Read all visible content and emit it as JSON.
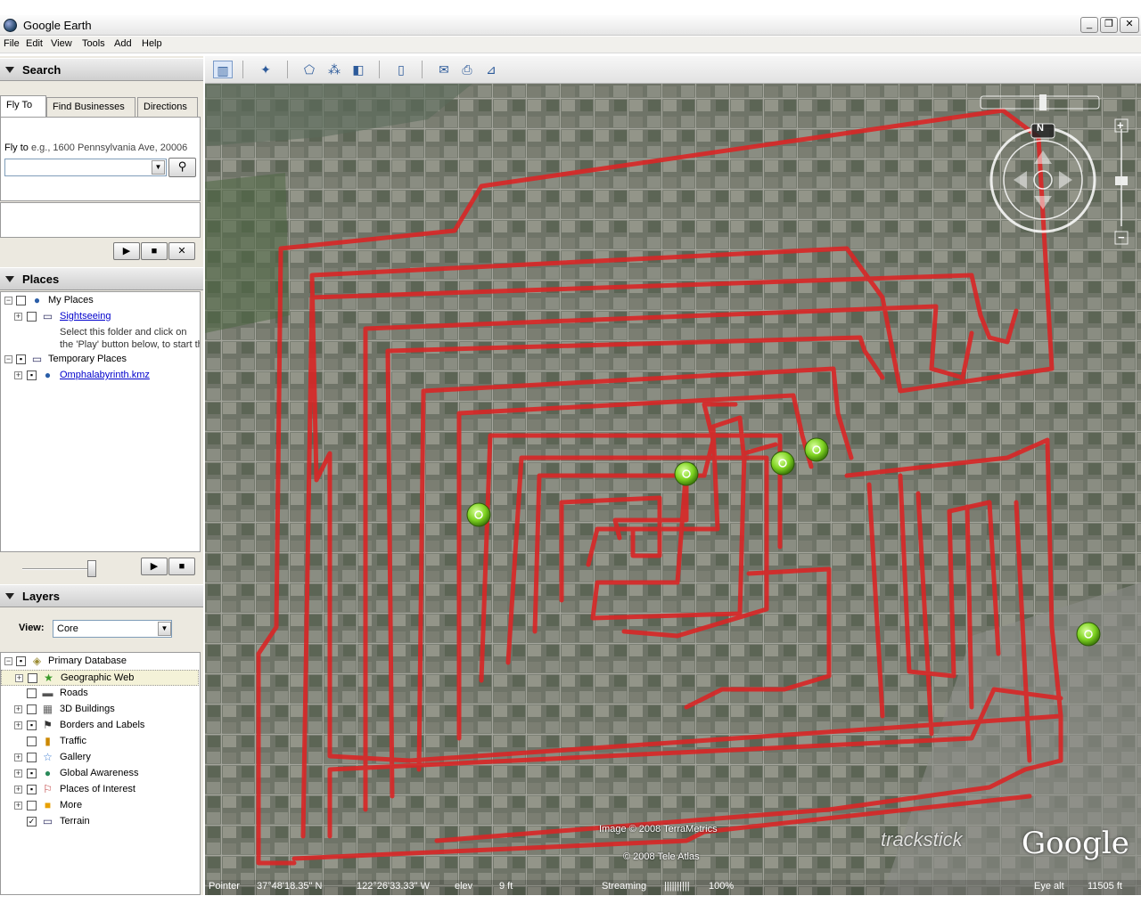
{
  "window": {
    "title": "Google Earth"
  },
  "menu": [
    "File",
    "Edit",
    "View",
    "Tools",
    "Add",
    "Help"
  ],
  "search": {
    "header": "Search",
    "tabs": [
      "Fly To",
      "Find Businesses",
      "Directions"
    ],
    "fly_to_label": "Fly to",
    "fly_to_hint": "e.g., 1600 Pennsylvania Ave, 20006",
    "input_value": ""
  },
  "places": {
    "header": "Places",
    "items": [
      {
        "label": "My Places",
        "checked": false
      },
      {
        "label": "Sightseeing",
        "checked": false
      },
      {
        "label": "Select this folder and click on"
      },
      {
        "label": "the 'Play' button below, to start th"
      },
      {
        "label": "Temporary Places",
        "checked": true
      },
      {
        "label": "Omphalabyrinth.kmz",
        "checked": true
      }
    ]
  },
  "layers": {
    "header": "Layers",
    "view_label": "View:",
    "view_value": "Core",
    "items": [
      {
        "label": "Primary Database"
      },
      {
        "label": "Geographic Web"
      },
      {
        "label": "Roads"
      },
      {
        "label": "3D Buildings"
      },
      {
        "label": "Borders and Labels"
      },
      {
        "label": "Traffic"
      },
      {
        "label": "Gallery"
      },
      {
        "label": "Global Awareness"
      },
      {
        "label": "Places of Interest"
      },
      {
        "label": "More"
      },
      {
        "label": "Terrain"
      }
    ]
  },
  "map": {
    "credits": [
      "Image © 2008 TerraMetrics",
      "© 2008 Tele Atlas"
    ],
    "trackstick": "trackstick",
    "logo": "Google",
    "compass_n": "N"
  },
  "status": {
    "pointer_label": "Pointer",
    "lat": "37°48'18.35\" N",
    "lon": "122°26'33.33\" W",
    "elev_label": "elev",
    "elev_value": "9 ft",
    "streaming_label": "Streaming",
    "streaming_bars": "||||||||||",
    "streaming_pct": "100%",
    "eye_alt_label": "Eye alt",
    "eye_alt_value": "11505 ft"
  },
  "colors": {
    "track": "#d92626",
    "marker": "#7ed321"
  }
}
